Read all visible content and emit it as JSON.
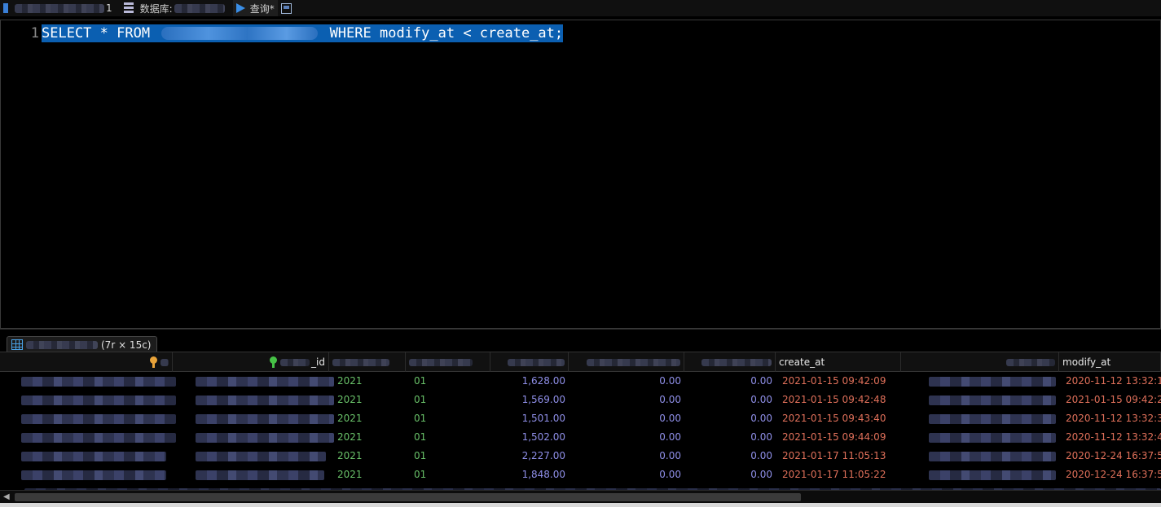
{
  "toolbar": {
    "database_label": "数据库:",
    "query_tab_label": "查询*"
  },
  "editor": {
    "line_number": "1",
    "query_prefix": "SELECT * FROM",
    "query_suffix": "WHERE modify_at < create_at;"
  },
  "results_tab": {
    "dims": "(7r × 15c)"
  },
  "grid": {
    "columns": [
      {
        "label": "",
        "key": "orange-key-icon"
      },
      {
        "label": "_id",
        "key": "green-key-icon"
      },
      {
        "label": ""
      },
      {
        "label": ""
      },
      {
        "label": ""
      },
      {
        "label": ""
      },
      {
        "label": ""
      },
      {
        "label": "create_at"
      },
      {
        "label": ""
      },
      {
        "label": "modify_at"
      }
    ],
    "rows": [
      {
        "year": "2021",
        "month": "01",
        "amount": "1,628.00",
        "v1": "0.00",
        "v2": "0.00",
        "create_at": "2021-01-15 09:42:09",
        "modify_at": "2020-11-12 13:32:1"
      },
      {
        "year": "2021",
        "month": "01",
        "amount": "1,569.00",
        "v1": "0.00",
        "v2": "0.00",
        "create_at": "2021-01-15 09:42:48",
        "modify_at": "2021-01-15 09:42:2"
      },
      {
        "year": "2021",
        "month": "01",
        "amount": "1,501.00",
        "v1": "0.00",
        "v2": "0.00",
        "create_at": "2021-01-15 09:43:40",
        "modify_at": "2020-11-12 13:32:3"
      },
      {
        "year": "2021",
        "month": "01",
        "amount": "1,502.00",
        "v1": "0.00",
        "v2": "0.00",
        "create_at": "2021-01-15 09:44:09",
        "modify_at": "2020-11-12 13:32:4"
      },
      {
        "year": "2021",
        "month": "01",
        "amount": "2,227.00",
        "v1": "0.00",
        "v2": "0.00",
        "create_at": "2021-01-17 11:05:13",
        "modify_at": "2020-12-24 16:37:5"
      },
      {
        "year": "2021",
        "month": "01",
        "amount": "1,848.00",
        "v1": "0.00",
        "v2": "0.00",
        "create_at": "2021-01-17 11:05:22",
        "modify_at": "2020-12-24 16:37:5"
      }
    ]
  },
  "colors": {
    "selection": "#0b5fb1",
    "year_month": "#69c169",
    "number": "#8f8fe8",
    "date": "#e0705a"
  }
}
